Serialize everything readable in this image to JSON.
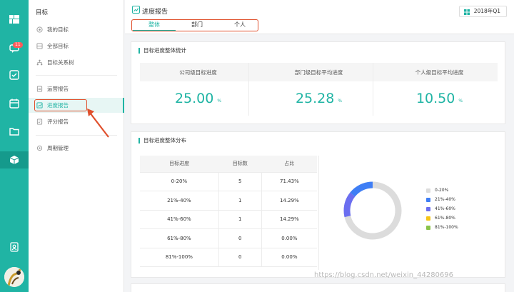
{
  "rail": {
    "badge": "11",
    "icons": [
      "grid-icon",
      "chat-icon",
      "check-icon",
      "calendar-icon",
      "folder-icon",
      "cube-icon",
      "contact-icon"
    ]
  },
  "sidebar": {
    "title": "目标",
    "items": [
      {
        "label": "我的目标",
        "icon": "target-icon"
      },
      {
        "label": "全部目标",
        "icon": "layers-icon"
      },
      {
        "label": "目标关系树",
        "icon": "tree-icon"
      },
      {
        "label": "运营报告",
        "icon": "report-icon"
      },
      {
        "label": "进度报告",
        "icon": "progress-icon"
      },
      {
        "label": "评分报告",
        "icon": "score-icon"
      },
      {
        "label": "周期管理",
        "icon": "cycle-icon"
      }
    ]
  },
  "header": {
    "title": "进度报告",
    "quarter": "2018年Q1",
    "tabs": [
      {
        "label": "整体",
        "active": true
      },
      {
        "label": "部门",
        "active": false
      },
      {
        "label": "个人",
        "active": false
      }
    ]
  },
  "overall": {
    "title": "目标进度整体统计",
    "stats": [
      {
        "label": "公司级目标进度",
        "value": "25.00",
        "unit": "%"
      },
      {
        "label": "部门级目标平均进度",
        "value": "25.28",
        "unit": "%"
      },
      {
        "label": "个人级目标平均进度",
        "value": "10.50",
        "unit": "%"
      }
    ]
  },
  "distribution": {
    "title": "目标进度整体分布",
    "columns": [
      "目标进度",
      "目标数",
      "占比"
    ],
    "rows": [
      [
        "0-20%",
        "5",
        "71.43%"
      ],
      [
        "21%-40%",
        "1",
        "14.29%"
      ],
      [
        "41%-60%",
        "1",
        "14.29%"
      ],
      [
        "61%-80%",
        "0",
        "0.00%"
      ],
      [
        "81%-100%",
        "0",
        "0.00%"
      ]
    ],
    "legend": [
      {
        "label": "0-20%",
        "color": "#dcdcdc"
      },
      {
        "label": "21%-40%",
        "color": "#3f7ef5"
      },
      {
        "label": "41%-60%",
        "color": "#6b6ef0"
      },
      {
        "label": "61%-80%",
        "color": "#f5c518"
      },
      {
        "label": "81%-100%",
        "color": "#8bc34a"
      }
    ],
    "donut": [
      71.43,
      14.29,
      14.29,
      0,
      0
    ]
  },
  "footer": {
    "watermark": "https://blog.csdn.net/weixin_44280696"
  },
  "colors": {
    "accent": "#20b4a4",
    "highlight": "#e0502d"
  }
}
